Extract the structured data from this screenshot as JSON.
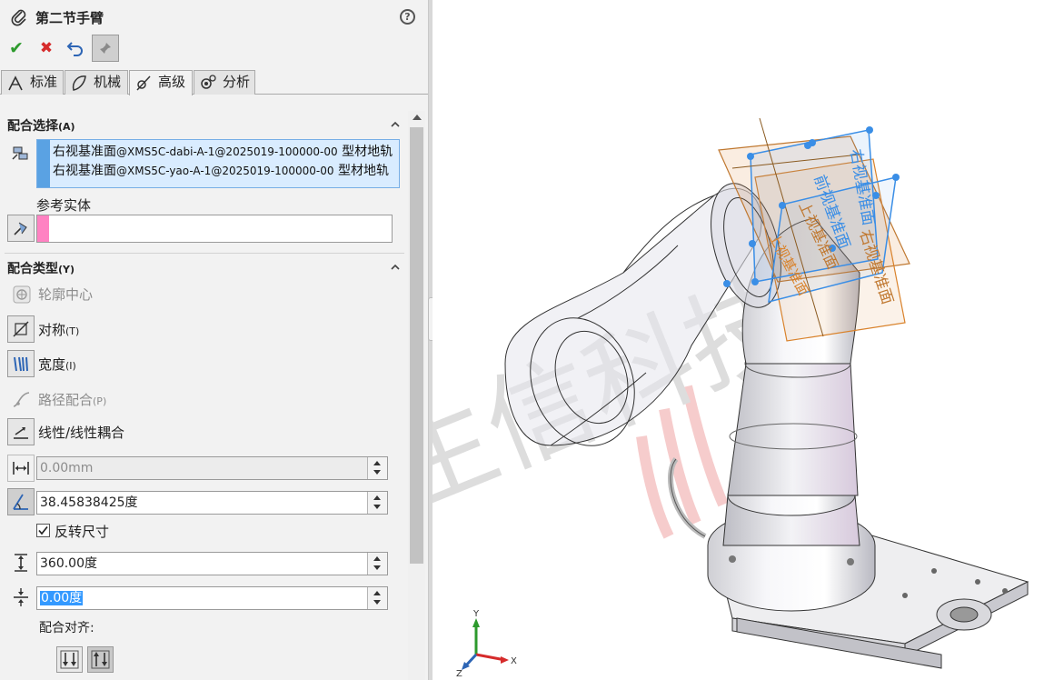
{
  "panel": {
    "title": "第二节手臂",
    "help_label": "?",
    "tabs": [
      {
        "label": "标准",
        "icon": "standard-mates-icon"
      },
      {
        "label": "机械",
        "icon": "mechanical-mates-icon"
      },
      {
        "label": "高级",
        "icon": "advanced-mates-icon"
      },
      {
        "label": "分析",
        "icon": "analysis-icon"
      }
    ],
    "mate_selections": {
      "header": "配合选择",
      "header_key": "(A)",
      "items": [
        {
          "main": "右视基准面",
          "path": "@XMS5C-dabi-A-1@2025019-100000-00",
          "suffix": " 型材地轨"
        },
        {
          "main": "右视基准面",
          "path": "@XMS5C-yao-A-1@2025019-100000-00",
          "suffix": " 型材地轨"
        }
      ],
      "reference_label": "参考实体"
    },
    "mate_types": {
      "header": "配合类型",
      "header_key": "(Y)",
      "profile_center": "轮廓中心",
      "symmetric": "对称",
      "symmetric_key": "(T)",
      "width": "宽度",
      "width_key": "(I)",
      "path_mate": "路径配合",
      "path_mate_key": "(P)",
      "linear_coupler": "线性/线性耦合",
      "distance_value": "0.00mm",
      "angle_value": "38.45838425度",
      "flip_dimension_label": "反转尺寸",
      "flip_dimension_checked": true,
      "max_value": "360.00度",
      "min_value": "0.00度",
      "mate_alignment_label": "配合对齐:"
    }
  },
  "viewport": {
    "watermark_text": "生信科技",
    "triad": {
      "x": "X",
      "y": "Y",
      "z": "Z"
    },
    "plane_labels": [
      "右视基准面",
      "前视基准面",
      "上视基准面",
      "右视基准面",
      "上视基准面"
    ]
  },
  "colors": {
    "accept": "#2e9b2e",
    "cancel": "#d62b2b",
    "selection_bar": "#5aa2e3",
    "reference_bar": "#ff82c2",
    "plane_blue": "#3a8ee6",
    "plane_orange": "#d9822b",
    "watermark": "#e04a4a"
  }
}
